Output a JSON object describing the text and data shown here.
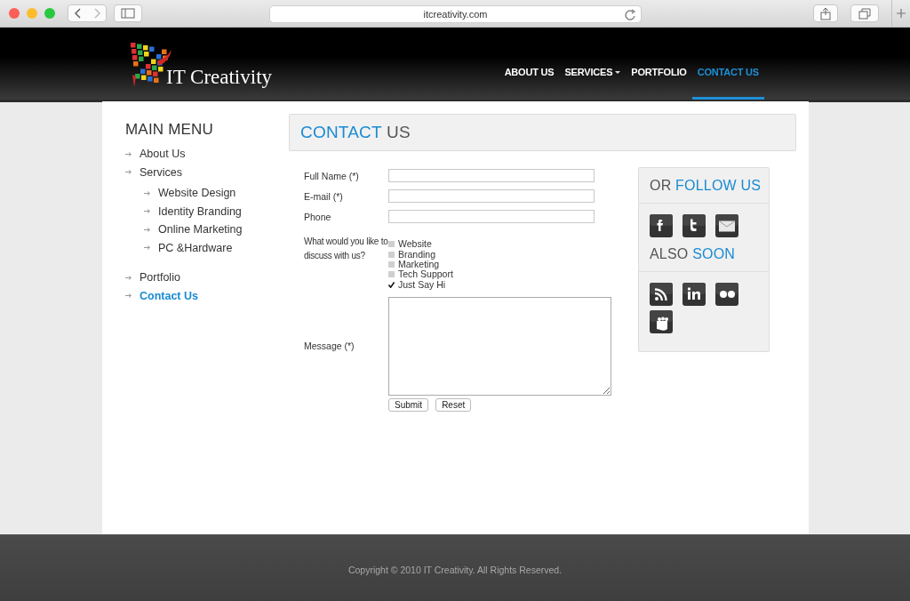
{
  "browser": {
    "url": "itcreativity.com"
  },
  "header": {
    "logo_text": "IT Creativity",
    "nav": [
      {
        "label": "ABOUT US",
        "selected": false,
        "has_dropdown": false
      },
      {
        "label": "SERVICES",
        "selected": false,
        "has_dropdown": true
      },
      {
        "label": "PORTFOLIO",
        "selected": false,
        "has_dropdown": false
      },
      {
        "label": "CONTACT US",
        "selected": true,
        "has_dropdown": false
      }
    ]
  },
  "sidebar": {
    "title": "MAIN MENU",
    "items": [
      {
        "label": "About Us",
        "selected": false
      },
      {
        "label": "Services",
        "selected": false,
        "children": [
          {
            "label": "Website Design",
            "selected": false
          },
          {
            "label": "Identity Branding",
            "selected": false
          },
          {
            "label": "Online Marketing",
            "selected": false
          },
          {
            "label": "PC &Hardware",
            "selected": false
          }
        ]
      },
      {
        "label": "Portfolio",
        "selected": false
      },
      {
        "label": "Contact Us",
        "selected": true
      }
    ]
  },
  "page_heading": [
    {
      "text": "CONTACT",
      "accent": true
    },
    {
      "text": "US",
      "accent": false
    }
  ],
  "form": {
    "fields": [
      {
        "label": "Full Name (*)",
        "kind": "text"
      },
      {
        "label": "E-mail (*)",
        "kind": "text"
      },
      {
        "label": "Phone",
        "kind": "text"
      },
      {
        "label": "What would you like to discuss with us?",
        "kind": "checklist",
        "options": [
          {
            "label": "Website",
            "checked": false
          },
          {
            "label": "Branding",
            "checked": false
          },
          {
            "label": "Marketing",
            "checked": false
          },
          {
            "label": "Tech Support",
            "checked": false
          },
          {
            "label": "Just Say Hi",
            "checked": true
          }
        ]
      },
      {
        "label": "Message (*)",
        "kind": "textarea"
      }
    ],
    "buttons": [
      "Submit",
      "Reset"
    ]
  },
  "follow_box": {
    "sections": [
      {
        "title": [
          {
            "text": "OR",
            "accent": false
          },
          {
            "text": "FOLLOW US",
            "accent": true
          }
        ]
      },
      {
        "title": [
          {
            "text": "ALSO",
            "accent": false
          },
          {
            "text": "SOON",
            "accent": true
          }
        ]
      }
    ]
  },
  "footer": {
    "text": "Copyright © 2010 IT Creativity. All Rights Reserved."
  }
}
